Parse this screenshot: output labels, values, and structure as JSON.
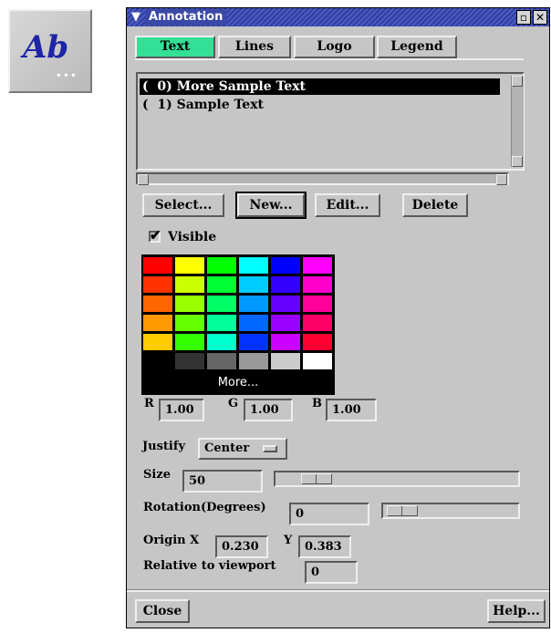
{
  "icon": {
    "glyph": "Ab",
    "dots": "•••"
  },
  "window": {
    "title": "Annotation",
    "menu_icon": "chevron-down-icon",
    "minimize_glyph": "▫",
    "close_glyph": "✕"
  },
  "tabs": [
    {
      "label": "Text",
      "active": true
    },
    {
      "label": "Lines",
      "active": false
    },
    {
      "label": "Logo",
      "active": false
    },
    {
      "label": "Legend",
      "active": false
    }
  ],
  "list": {
    "items": [
      {
        "text": "(  0) More Sample Text",
        "selected": true
      },
      {
        "text": "(  1) Sample Text",
        "selected": false
      }
    ]
  },
  "actions": {
    "select": "Select...",
    "new": "New...",
    "edit": "Edit...",
    "delete": "Delete"
  },
  "visible": {
    "label": "Visible",
    "checked": true,
    "check_glyph": "✔"
  },
  "palette": {
    "more_label": "More...",
    "rows": [
      [
        "#ff0000",
        "#ffff00",
        "#00ff00",
        "#00ffff",
        "#0000ff",
        "#ff00ff"
      ],
      [
        "#ff3300",
        "#ccff00",
        "#00ff33",
        "#00ccff",
        "#3300ff",
        "#ff00cc"
      ],
      [
        "#ff6600",
        "#99ff00",
        "#00ff66",
        "#0099ff",
        "#6600ff",
        "#ff0099"
      ],
      [
        "#ff9900",
        "#66ff00",
        "#00ff99",
        "#0066ff",
        "#9900ff",
        "#ff0066"
      ],
      [
        "#ffcc00",
        "#33ff00",
        "#00ffcc",
        "#0033ff",
        "#cc00ff",
        "#ff0033"
      ],
      [
        "#000000",
        "#333333",
        "#666666",
        "#999999",
        "#cccccc",
        "#ffffff"
      ]
    ]
  },
  "rgb": {
    "r_label": "R",
    "r": "1.00",
    "g_label": "G",
    "g": "1.00",
    "b_label": "B",
    "b": "1.00"
  },
  "justify": {
    "label": "Justify",
    "value": "Center"
  },
  "size": {
    "label": "Size",
    "value": "50"
  },
  "rotation": {
    "label": "Rotation(Degrees)",
    "value": "0"
  },
  "origin": {
    "x_label": "Origin X",
    "x": "0.230",
    "y_label": "Y",
    "y": "0.383"
  },
  "relative": {
    "label": "Relative to viewport",
    "value": "0"
  },
  "footer": {
    "close": "Close",
    "help": "Help..."
  }
}
